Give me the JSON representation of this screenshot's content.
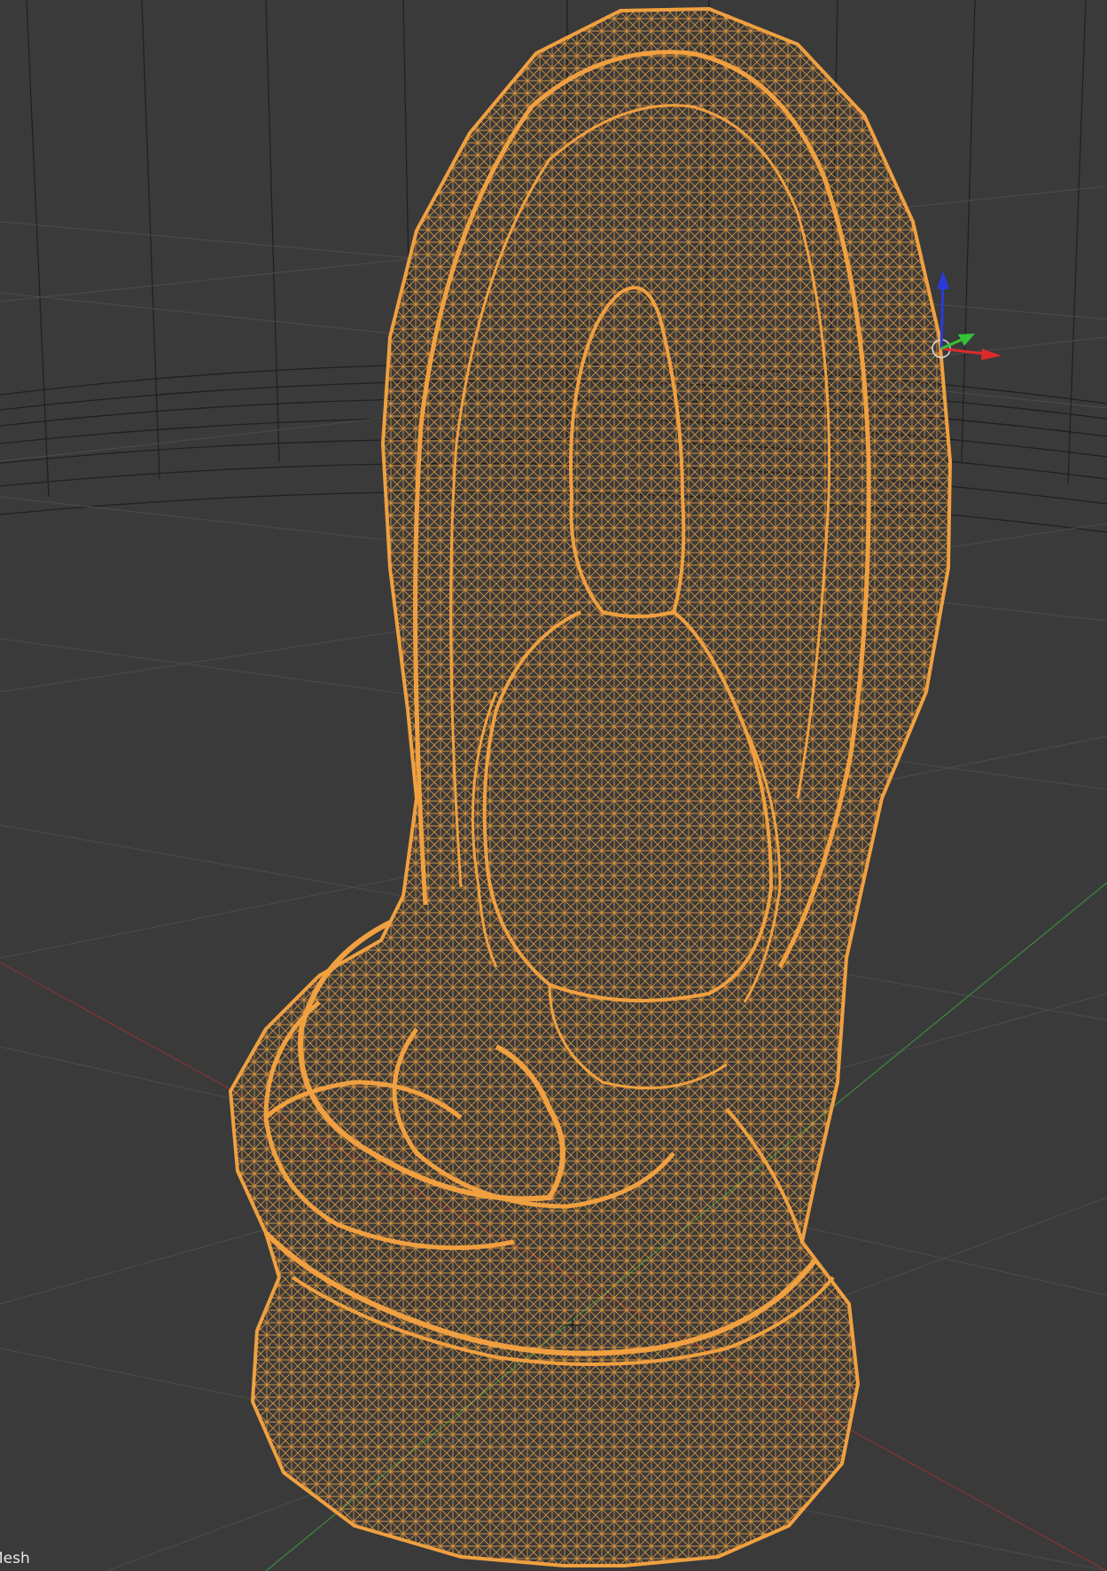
{
  "viewport": {
    "background_color": "#3a3a3a",
    "grid_color": "#4b4b4b",
    "gizmo_ring_color": "#d8d8d8",
    "object_label": "Mesh"
  },
  "mesh": {
    "wire_color": "#f0a040",
    "shape": "seated-buddha-statue-with-halo"
  },
  "axes": {
    "x_color": "#dd2a2a",
    "y_color": "#36c236",
    "z_color": "#2a3ad8"
  }
}
